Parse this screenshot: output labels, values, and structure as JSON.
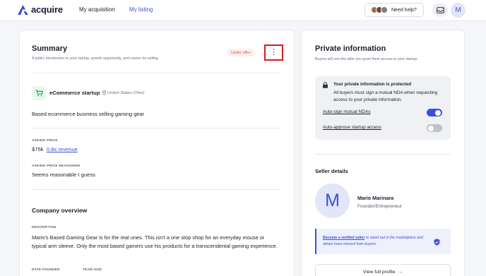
{
  "header": {
    "logo_text": "acquire",
    "nav": [
      "My acquisition",
      "My listing"
    ],
    "help_label": "Need help?",
    "avatar_initial": "M",
    "colors": {
      "accent": "#3b4fd8"
    }
  },
  "summary": {
    "title": "Summary",
    "subtitle": "A public introduction to your startup, growth opportunity, and reason for selling.",
    "badge": "Under offer",
    "menu_icon": "⋮",
    "startup_name": "eCommerce startup",
    "location": "United States (Ohio)",
    "description": "Based ecommerce business selling gaming gear",
    "asking_price_label": "ASKING PRICE",
    "asking_price": "$75k",
    "asking_price_multiple": "0.8x revenue",
    "reasoning_label": "ASKING PRICE REASONING",
    "reasoning": "Seems reasonable I guess"
  },
  "company_overview": {
    "title": "Company overview",
    "description_label": "DESCRIPTION",
    "description": "Mario's Based Gaming Gear is for the real ones. This isn't a one stop shop for an everyday mouse or typical arm sleeve. Only the most based gamers use his products for a transcendental gaming experience.",
    "date_founded_label": "DATE FOUNDED",
    "team_size_label": "TEAM SIZE"
  },
  "private_info": {
    "title": "Private information",
    "subtitle": "Buyers will see this after you grant them access to your startup.",
    "protected_title": "Your private information is protected",
    "protected_text": "All buyers must sign a mutual NDA when requesting access to your private information.",
    "toggles": [
      {
        "label": "Auto-sign mutual NDAs",
        "on": true
      },
      {
        "label": "Auto-approve startup access",
        "on": false
      }
    ]
  },
  "seller": {
    "title": "Seller details",
    "initial": "M",
    "name": "Mario Marinara",
    "role": "Founder/Entrepreneur",
    "verify_link": "Become a verified seller",
    "verify_text": "to stand out in the marketplace and attract more interest from buyers.",
    "profile_button": "View full profile",
    "profile_arrow": "→"
  }
}
